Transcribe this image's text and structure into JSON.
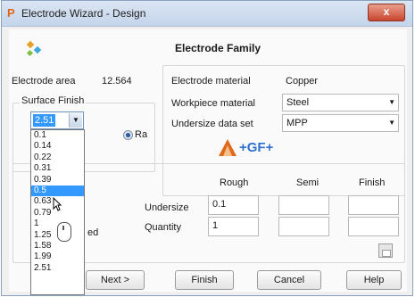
{
  "window": {
    "logo": "P",
    "title": "Electrode Wizard - Design",
    "close": "x"
  },
  "header": {
    "family_title": "Electrode Family"
  },
  "electrode_area": {
    "label": "Electrode area",
    "value": "12.564"
  },
  "surface_finish": {
    "group_label": "Surface Finish",
    "selected": "2.51",
    "radio_label": "Ra",
    "options": [
      "0.1",
      "0.14",
      "0.22",
      "0.31",
      "0.39",
      "0.5",
      "0.63",
      "0.79",
      "1",
      "1.25",
      "1.58",
      "1.99",
      "2.51"
    ],
    "highlighted": "0.5"
  },
  "material": {
    "electrode_material_label": "Electrode material",
    "electrode_material_value": "Copper",
    "workpiece_material_label": "Workpiece material",
    "workpiece_material_value": "Steel",
    "undersize_data_set_label": "Undersize data set",
    "undersize_data_set_value": "MPP",
    "logo_text": "+GF+"
  },
  "grid": {
    "columns": [
      "Rough",
      "Semi",
      "Finish"
    ],
    "undersize_label": "Undersize",
    "quantity_label": "Quantity",
    "undersize_rough": "0.1",
    "quantity_rough": "1",
    "partial_label": "ed"
  },
  "buttons": {
    "next": "Next >",
    "finish": "Finish",
    "cancel": "Cancel",
    "help": "Help"
  },
  "colors": {
    "accent": "#3399ff",
    "logo_blue": "#2f6fd0",
    "logo_orange": "#e06a1c",
    "close_red": "#c8462e"
  }
}
